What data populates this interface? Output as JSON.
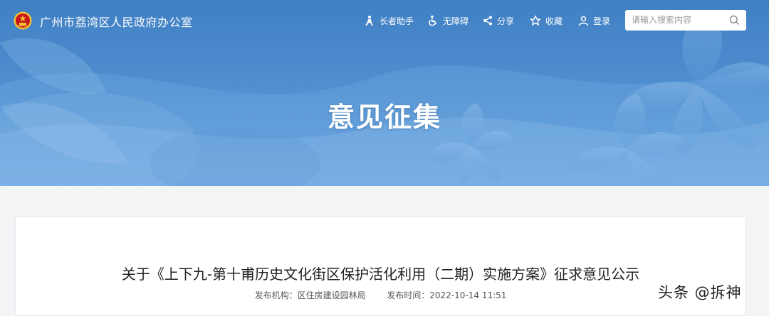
{
  "site": {
    "title": "广州市荔湾区人民政府办公室"
  },
  "nav": {
    "items": [
      {
        "label": "长者助手",
        "icon": "elderly-icon"
      },
      {
        "label": "无障碍",
        "icon": "wheelchair-icon"
      },
      {
        "label": "分享",
        "icon": "share-icon"
      },
      {
        "label": "收藏",
        "icon": "star-icon"
      },
      {
        "label": "登录",
        "icon": "user-icon"
      }
    ]
  },
  "search": {
    "placeholder": "请输入搜索内容",
    "icon": "search-icon"
  },
  "hero": {
    "title": "意见征集"
  },
  "article": {
    "title": "关于《上下九-第十甫历史文化街区保护活化利用（二期）实施方案》征求意见公示",
    "publisher_label": "发布机构：",
    "publisher": "区住房建设园林局",
    "time_label": "发布时间：",
    "time": "2022-10-14 11:51"
  },
  "watermark": {
    "text": "头条 @拆神"
  },
  "colors": {
    "header_blue": "#3f7fc3",
    "page_bg": "#f3f4f6",
    "emblem_red": "#c8141e",
    "emblem_gold": "#f2c230"
  }
}
